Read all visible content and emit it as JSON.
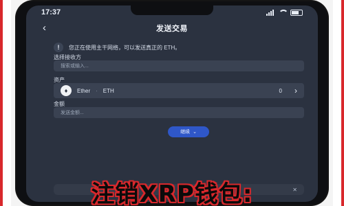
{
  "status_bar": {
    "time": "17:37"
  },
  "header": {
    "title": "发送交易",
    "back_icon": "chevron-left-icon"
  },
  "notice": {
    "text": "您正在使用主干网络，可以发送真正的 ETH。"
  },
  "recipient": {
    "label": "选择接收方",
    "placeholder": "搜索或输入..."
  },
  "asset": {
    "label": "资产",
    "token_name": "Ether",
    "token_symbol": "ETH",
    "balance": "0"
  },
  "amount": {
    "label": "金额",
    "placeholder": "发送金额..."
  },
  "next_button": {
    "label": "继续"
  },
  "bottom_bar": {
    "left": "",
    "right": ""
  },
  "caption": "注销XRP钱包:",
  "colors": {
    "accent": "#2f57c8",
    "background": "#2b3240",
    "caption_outline": "#d8282c"
  }
}
